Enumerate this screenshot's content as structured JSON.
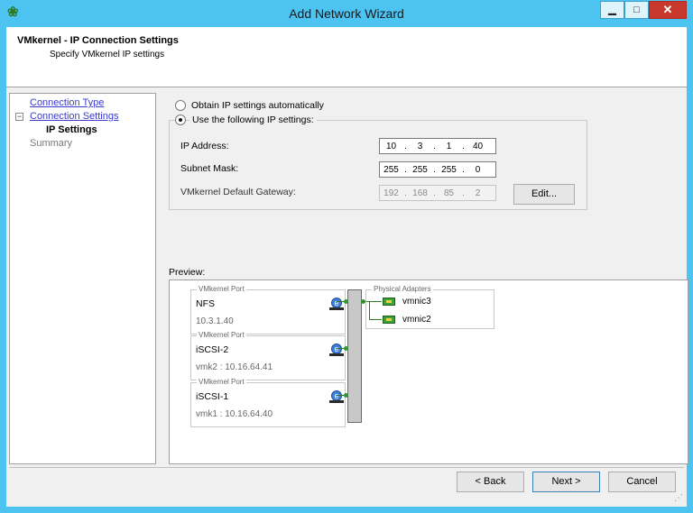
{
  "window": {
    "title": "Add Network Wizard",
    "minimize": "▁",
    "maximize": "□",
    "close": "✕",
    "accent": "#4cc3f0"
  },
  "header": {
    "title": "VMkernel - IP Connection Settings",
    "subtitle": "Specify VMkernel IP settings"
  },
  "nav": {
    "items": [
      {
        "label": "Connection Type"
      },
      {
        "label": "Connection Settings"
      },
      {
        "label": "IP Settings"
      },
      {
        "label": "Summary"
      }
    ],
    "expander": "−"
  },
  "ip_settings": {
    "auto_label": "Obtain IP settings automatically",
    "manual_label": "Use the following IP settings:",
    "selected": "manual",
    "ip_address": {
      "label": "IP Address:",
      "octets": [
        "10",
        "3",
        "1",
        "40"
      ]
    },
    "subnet_mask": {
      "label": "Subnet Mask:",
      "octets": [
        "255",
        "255",
        "255",
        "0"
      ]
    },
    "gateway": {
      "label": "VMkernel Default Gateway:",
      "octets": [
        "192",
        "168",
        "85",
        "2"
      ]
    },
    "edit_button": "Edit..."
  },
  "preview": {
    "label": "Preview:",
    "ports": [
      {
        "legend": "VMkernel Port",
        "name": "NFS",
        "detail": "10.3.1.40"
      },
      {
        "legend": "VMkernel Port",
        "name": "iSCSI-2",
        "detail": "vmk2 : 10.16.64.41"
      },
      {
        "legend": "VMkernel Port",
        "name": "iSCSI-1",
        "detail": "vmk1 : 10.16.64.40"
      }
    ],
    "adapters_legend": "Physical Adapters",
    "adapters": [
      "vmnic3",
      "vmnic2"
    ]
  },
  "footer": {
    "back": "< Back",
    "next": "Next >",
    "cancel": "Cancel"
  }
}
